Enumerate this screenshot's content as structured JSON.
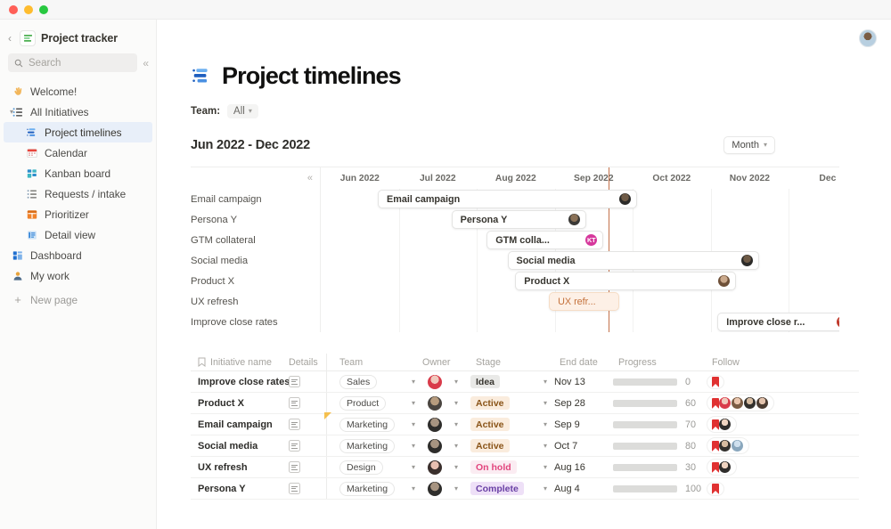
{
  "window": {
    "controls": [
      "close",
      "minimize",
      "maximize"
    ]
  },
  "sidebar": {
    "workspace": "Project tracker",
    "search": {
      "placeholder": "Search"
    },
    "items": [
      {
        "label": "Welcome!",
        "icon": "wave-icon",
        "level": 0,
        "active": false
      },
      {
        "label": "All Initiatives",
        "icon": "list-icon",
        "level": 0,
        "active": false,
        "expandable": true
      },
      {
        "label": "Project timelines",
        "icon": "timeline-icon",
        "level": 1,
        "active": true
      },
      {
        "label": "Calendar",
        "icon": "calendar-icon",
        "level": 1,
        "active": false
      },
      {
        "label": "Kanban board",
        "icon": "kanban-icon",
        "level": 1,
        "active": false
      },
      {
        "label": "Requests / intake",
        "icon": "list-icon",
        "level": 1,
        "active": false
      },
      {
        "label": "Prioritizer",
        "icon": "table-icon",
        "level": 1,
        "active": false
      },
      {
        "label": "Detail view",
        "icon": "detail-icon",
        "level": 1,
        "active": false
      },
      {
        "label": "Dashboard",
        "icon": "dashboard-icon",
        "level": 0,
        "active": false
      },
      {
        "label": "My work",
        "icon": "person-icon",
        "level": 0,
        "active": false
      },
      {
        "label": "New page",
        "icon": "plus-icon",
        "level": 0,
        "active": false,
        "muted": true
      }
    ]
  },
  "header": {
    "avatar": "user-avatar"
  },
  "page": {
    "title": "Project timelines",
    "icon": "timeline-icon",
    "filter": {
      "label": "Team:",
      "value": "All"
    }
  },
  "gantt": {
    "range_title": "Jun 2022 - Dec 2022",
    "scale": {
      "value": "Month"
    },
    "months": [
      "Jun 2022",
      "Jul 2022",
      "Aug 2022",
      "Sep 2022",
      "Oct 2022",
      "Nov 2022",
      "Dec"
    ],
    "today_line_percent": 55.5,
    "rows": [
      {
        "label": "Email campaign",
        "bar_label": "Email campaign",
        "left_pct": 11.0,
        "width_pct": 50.0,
        "avatar": "m1",
        "style": "white"
      },
      {
        "label": "Persona Y",
        "bar_label": "Persona Y",
        "left_pct": 25.2,
        "width_pct": 26.0,
        "avatar": "m2",
        "style": "white"
      },
      {
        "label": "GTM collateral",
        "bar_label": "GTM colla...",
        "left_pct": 32.0,
        "width_pct": 22.5,
        "avatar": "kt",
        "avatar_initials": "KT",
        "style": "white"
      },
      {
        "label": "Social media",
        "bar_label": "Social media",
        "left_pct": 36.0,
        "width_pct": 48.5,
        "avatar": "m1",
        "style": "white"
      },
      {
        "label": "Product X",
        "bar_label": "Product X",
        "left_pct": 37.5,
        "width_pct": 42.5,
        "avatar": "brown",
        "style": "white"
      },
      {
        "label": "UX refresh",
        "bar_label": "UX refr...",
        "left_pct": 44.0,
        "width_pct": 13.5,
        "avatar": null,
        "style": "peach"
      },
      {
        "label": "Improve close rates",
        "bar_label": "Improve close r...",
        "left_pct": 76.5,
        "width_pct": 26.5,
        "avatar": "red",
        "style": "white"
      }
    ]
  },
  "table": {
    "columns": [
      "Initiative name",
      "Details",
      "Team",
      "Owner",
      "Stage",
      "End date",
      "Progress",
      "Follow"
    ],
    "rows": [
      {
        "name": "Improve close rates",
        "team": "Sales",
        "owner_avatar": "r1",
        "stage": "Idea",
        "stage_class": "s-idea",
        "end_date": "Nov 13",
        "progress": 0,
        "progress_color": "#dcdcda",
        "progress_label": "0",
        "followers": [],
        "flag": false
      },
      {
        "name": "Product X",
        "team": "Product",
        "owner_avatar": "r2",
        "stage": "Active",
        "stage_class": "s-active",
        "end_date": "Sep 28",
        "progress": 60,
        "progress_color": "#edad16",
        "progress_label": "60",
        "followers": [
          "a",
          "b",
          "c",
          "d"
        ],
        "flag": false
      },
      {
        "name": "Email campaign",
        "team": "Marketing",
        "owner_avatar": "r3",
        "stage": "Active",
        "stage_class": "s-active",
        "end_date": "Sep 9",
        "progress": 70,
        "progress_color": "#21a453",
        "progress_label": "70",
        "followers": [
          "e"
        ],
        "flag": true
      },
      {
        "name": "Social media",
        "team": "Marketing",
        "owner_avatar": "r3",
        "stage": "Active",
        "stage_class": "s-active",
        "end_date": "Oct 7",
        "progress": 80,
        "progress_color": "#21a453",
        "progress_label": "80",
        "followers": [
          "c",
          "f"
        ],
        "flag": false
      },
      {
        "name": "UX refresh",
        "team": "Design",
        "owner_avatar": "r4",
        "stage": "On hold",
        "stage_class": "s-onhold",
        "end_date": "Aug 16",
        "progress": 30,
        "progress_color": "#d91c1c",
        "progress_label": "30",
        "followers": [
          "e"
        ],
        "flag": false
      },
      {
        "name": "Persona Y",
        "team": "Marketing",
        "owner_avatar": "r3",
        "stage": "Complete",
        "stage_class": "s-complete",
        "end_date": "Aug 4",
        "progress": 100,
        "progress_color": "#21a453",
        "progress_label": "100",
        "followers": [],
        "flag": false
      }
    ]
  },
  "colors": {
    "accent_blue": "#2e7cf6",
    "today_line": "#c4724b",
    "green": "#21a453",
    "amber": "#edad16",
    "red": "#d91c1c",
    "selected_bg": "#e8eff9"
  }
}
